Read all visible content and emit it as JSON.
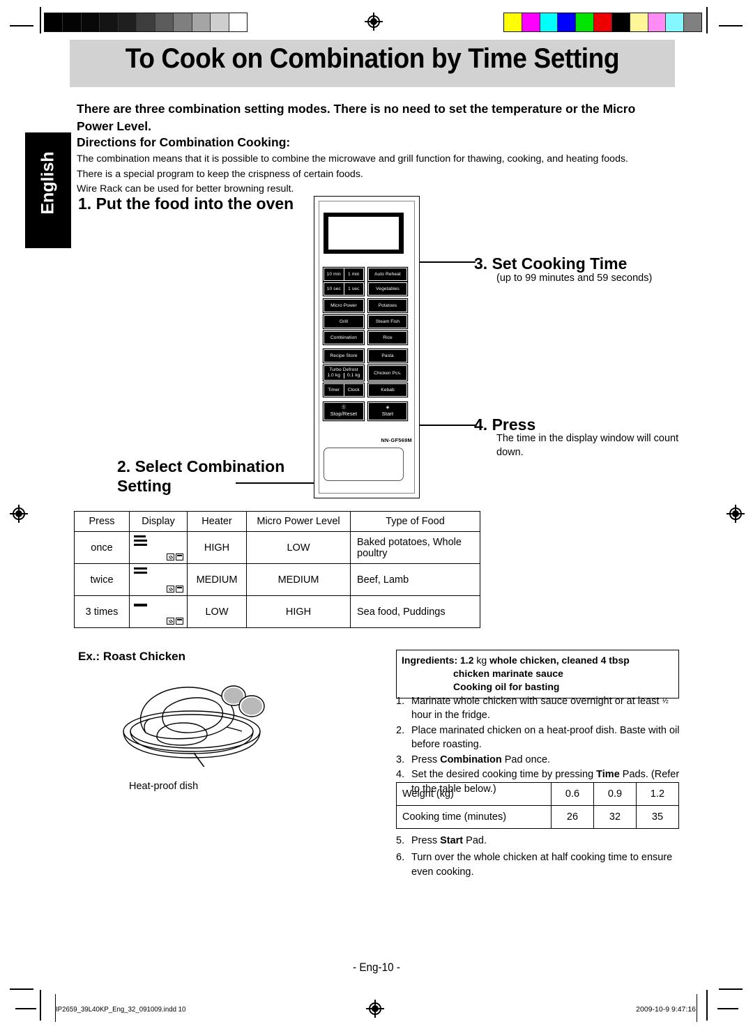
{
  "page_title": "To Cook on Combination by Time Setting",
  "language_tab": "English",
  "intro": {
    "lead": "There are three combination setting modes. There is no need to set the temperature or the Micro Power Level.",
    "directions_heading": "Directions for Combination Cooking:",
    "directions_body_line1": "The combination means that it is possible to combine the microwave and grill function for thawing, cooking, and heating foods.",
    "directions_body_line2": "There is a special program to keep the crispness of certain foods.",
    "directions_body_line3": "Wire Rack can be used for better browning result."
  },
  "steps": {
    "step1": "1. Put the food into the oven",
    "step2_line1": "2. Select Combination",
    "step2_line2": "Setting",
    "step3": "3. Set Cooking Time",
    "step3_sub": "(up to 99 minutes and 59 seconds)",
    "step4": "4. Press",
    "step4_sub": "The time in the display window will count down."
  },
  "control_panel": {
    "model": "NN-GF569M",
    "pads": {
      "time_10min": "10 min",
      "time_1min": "1 min",
      "time_10sec": "10 sec",
      "time_1sec": "1 sec",
      "micro_power": "Micro Power",
      "grill": "Grill",
      "combination": "Combination",
      "recipe_store": "Recipe Store",
      "turbo_defrost": "Turbo Defrost",
      "turbo_1kg": "1.0 kg",
      "turbo_01kg": "0.1 kg",
      "timer": "Timer",
      "clock": "Clock",
      "stop_reset": "Stop/Reset",
      "start": "Start",
      "auto_reheat": "Auto Reheat",
      "vegetables": "Vegetables",
      "potatoes": "Potatoes",
      "steam_fish": "Steam Fish",
      "rice": "Rice",
      "pasta": "Pasta",
      "chicken_pcs": "Chicken Pcs.",
      "kebab": "Kebab"
    },
    "icons": {
      "stop_reset": "stop-circle-icon",
      "start": "start-diamond-icon"
    }
  },
  "combination_table": {
    "headers": [
      "Press",
      "Display",
      "Heater",
      "Micro Power Level",
      "Type of Food"
    ],
    "rows": [
      {
        "press": "once",
        "bars": 3,
        "heater": "HIGH",
        "micro_power": "LOW",
        "food": "Baked potatoes, Whole poultry"
      },
      {
        "press": "twice",
        "bars": 2,
        "heater": "MEDIUM",
        "micro_power": "MEDIUM",
        "food": "Beef, Lamb"
      },
      {
        "press": "3 times",
        "bars": 1,
        "heater": "LOW",
        "micro_power": "HIGH",
        "food": "Sea food, Puddings"
      }
    ]
  },
  "example": {
    "title": "Ex.: Roast Chicken",
    "dish_caption": "Heat-proof dish",
    "ingredients": {
      "label": "Ingredients:",
      "amount": "1.2",
      "unit": "kg",
      "line1_rest": "whole chicken, cleaned 4 tbsp",
      "line2": "chicken marinate sauce",
      "line3": "Cooking oil for basting"
    },
    "steps": [
      {
        "n": "1.",
        "text": "Marinate whole chicken with sauce overnight or at least ½ hour in the fridge."
      },
      {
        "n": "2.",
        "text": "Place marinated chicken on a heat-proof dish. Baste with oil before roasting."
      },
      {
        "n": "3.",
        "text": "Press Combination Pad once.",
        "bold": "Combination"
      },
      {
        "n": "4.",
        "text": "Set the desired cooking time by pressing Time Pads. (Refer to the table below.)",
        "bold": "Time"
      }
    ],
    "post_steps": [
      {
        "n": "5.",
        "text": "Press Start Pad.",
        "bold": "Start"
      },
      {
        "n": "6.",
        "text": "Turn over the whole chicken at half cooking time to ensure even cooking."
      }
    ],
    "weight_table": {
      "row_labels": [
        "Weight (kg)",
        "Cooking time (minutes)"
      ],
      "weights": [
        "0.6",
        "0.9",
        "1.2"
      ],
      "times": [
        "26",
        "32",
        "35"
      ]
    }
  },
  "footer": {
    "page_number": "- Eng-10 -",
    "file_name": "IP2659_39L40KP_Eng_32_091009.indd   10",
    "timestamp": "2009-10-9   9:47:16"
  },
  "calibration": {
    "grayscale": [
      "#000000",
      "#030303",
      "#080808",
      "#141414",
      "#1f1f1f",
      "#3d3d3d",
      "#5c5c5c",
      "#7f7f7f",
      "#a5a5a5",
      "#cecece",
      "#ffffff"
    ],
    "colors": [
      "#ffff00",
      "#ff00ff",
      "#00ffff",
      "#0000ff",
      "#00e400",
      "#ee0000",
      "#000000",
      "#fff799",
      "#ff8cf5",
      "#85f8ff",
      "#808080"
    ]
  },
  "theme": {
    "banner_bg": "#d2d2d2",
    "ink": "#000000",
    "paper": "#ffffff"
  }
}
